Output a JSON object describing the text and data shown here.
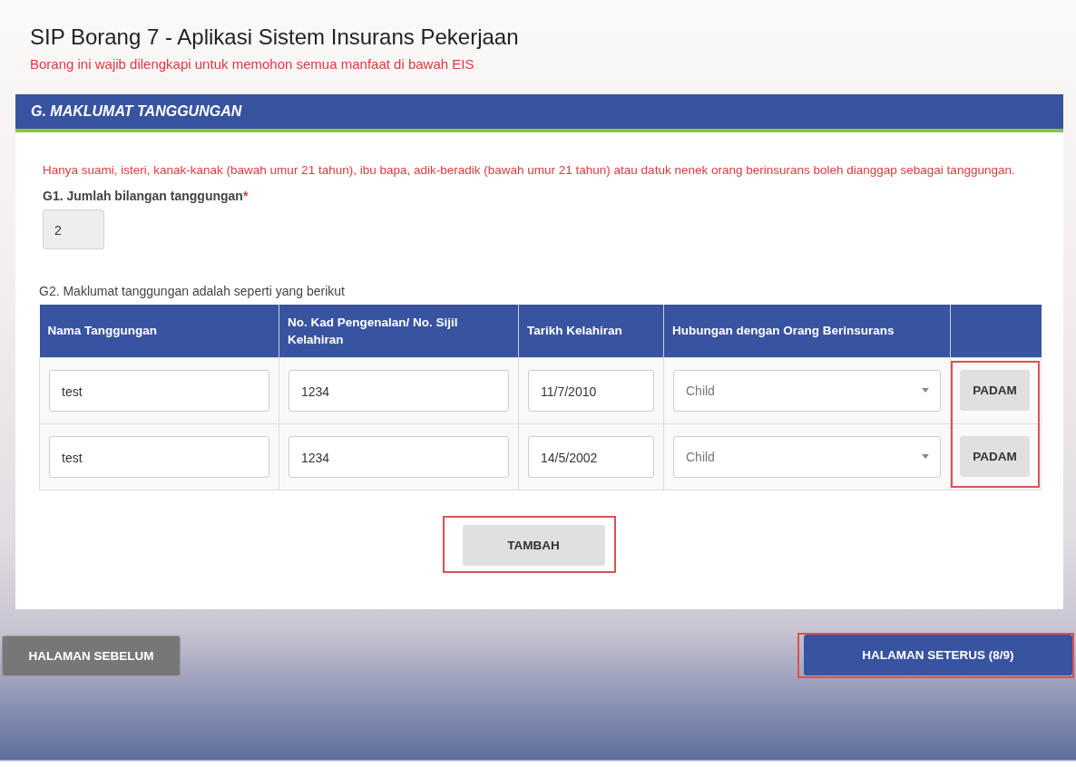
{
  "page": {
    "title": "SIP Borang 7 - Aplikasi Sistem Insurans Pekerjaan",
    "subtitle": "Borang ini wajib dilengkapi untuk memohon semua manfaat di bawah EIS"
  },
  "section": {
    "title": "G. MAKLUMAT TANGGUNGAN",
    "notice": "Hanya suami, isteri, kanak-kanak (bawah umur 21 tahun), ibu bapa, adik-beradik (bawah umur 21 tahun) atau datuk nenek orang berinsurans boleh dianggap sebagai tanggungan.",
    "g1": {
      "label": "G1. Jumlah bilangan tanggungan",
      "required_mark": "*",
      "value": "2"
    },
    "g2": {
      "label": "G2. Maklumat tanggungan adalah seperti yang berikut"
    }
  },
  "table": {
    "columns": [
      "Nama Tanggungan",
      "No. Kad Pengenalan/ No. Sijil Kelahiran",
      "Tarikh Kelahiran",
      "Hubungan dengan Orang Berinsurans"
    ],
    "rows": [
      {
        "name": "test",
        "id_no": "1234",
        "birth_date": "11/7/2010",
        "relation": "Child",
        "delete": "PADAM"
      },
      {
        "name": "test",
        "id_no": "1234",
        "birth_date": "14/5/2002",
        "relation": "Child",
        "delete": "PADAM"
      }
    ],
    "delete_column_highlighted": true
  },
  "add_button": {
    "label": "TAMBAH",
    "highlighted": true
  },
  "nav": {
    "previous": {
      "label": "HALAMAN SEBELUM"
    },
    "next": {
      "label": "HALAMAN SETERUS (8/9)",
      "highlighted": true
    }
  }
}
